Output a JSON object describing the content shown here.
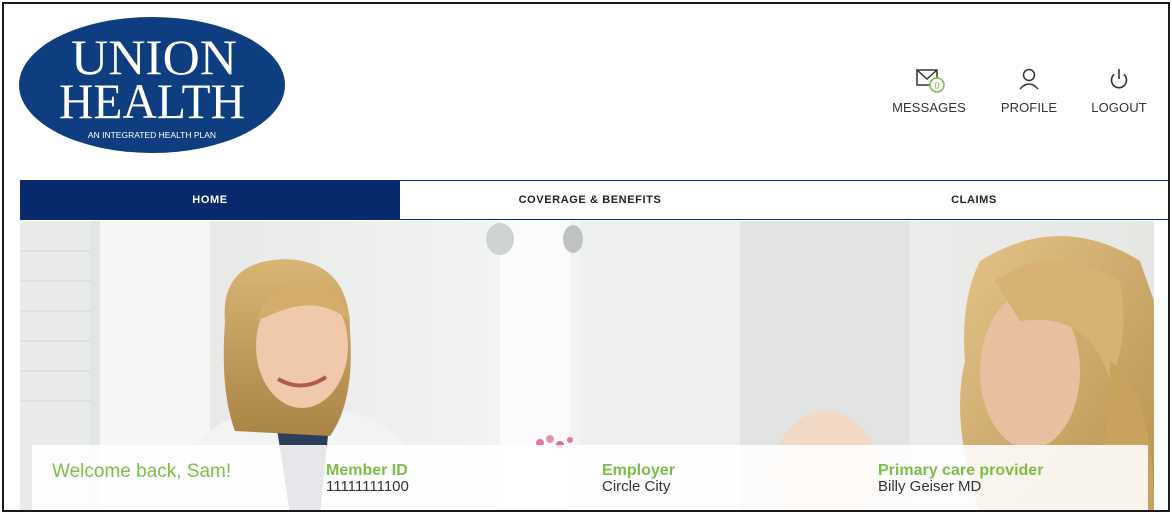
{
  "header": {
    "logo": {
      "line1": "UNION",
      "line2": "HEALTH",
      "tagline": "AN INTEGRATED HEALTH PLAN"
    },
    "messages": {
      "label": "MESSAGES",
      "count": "0",
      "icon": "envelope-icon"
    },
    "profile": {
      "label": "PROFILE",
      "icon": "user-icon"
    },
    "logout": {
      "label": "LOGOUT",
      "icon": "power-icon"
    }
  },
  "nav": {
    "tabs": [
      {
        "label": "HOME",
        "active": true
      },
      {
        "label": "COVERAGE & BENEFITS",
        "active": false
      },
      {
        "label": "CLAIMS",
        "active": false
      }
    ]
  },
  "member": {
    "welcome": "Welcome back, Sam!",
    "member_id_label": "Member ID",
    "member_id": "11111111100",
    "employer_label": "Employer",
    "employer": "Circle City",
    "pcp_label": "Primary care provider",
    "pcp": "Billy Geiser MD"
  },
  "colors": {
    "brand_navy": "#062a6b",
    "accent_green": "#7cbe47"
  }
}
